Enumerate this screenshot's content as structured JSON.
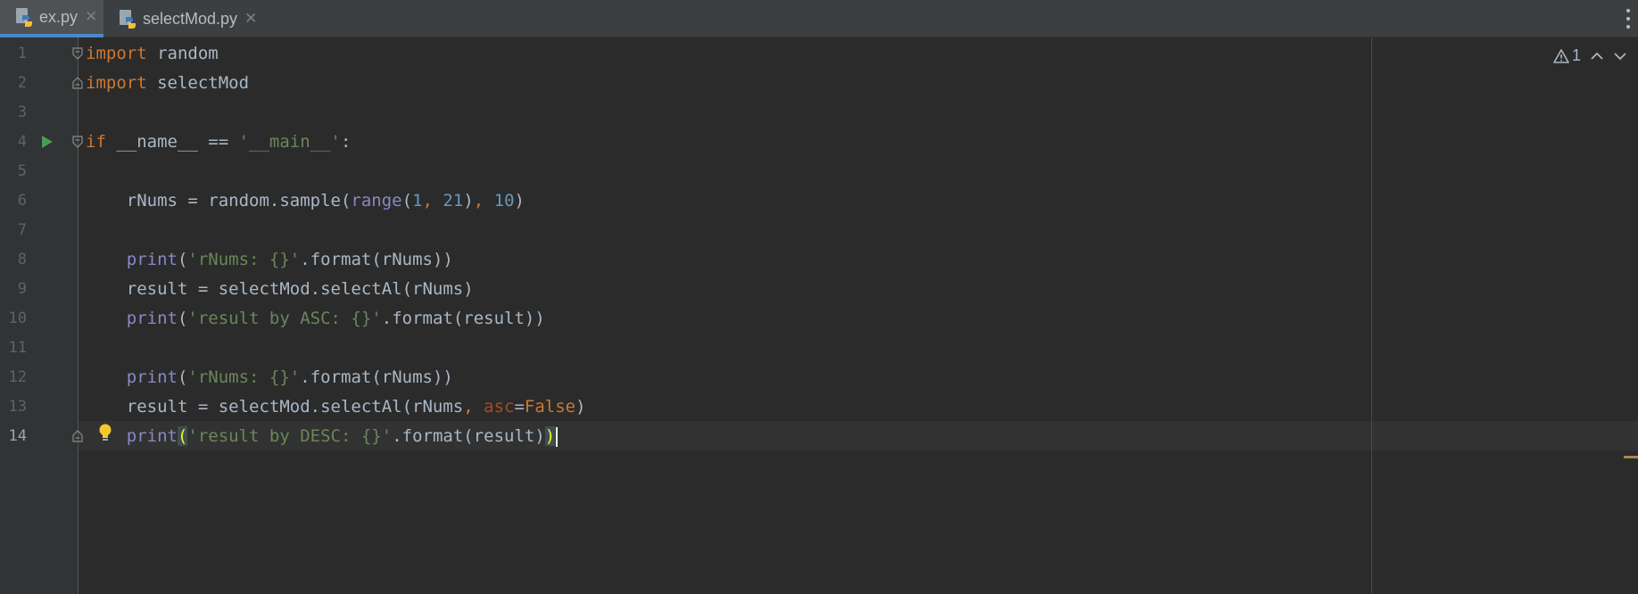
{
  "tabs": [
    {
      "name": "ex.py",
      "active": true
    },
    {
      "name": "selectMod.py",
      "active": false
    }
  ],
  "tab_close_glyph": "✕",
  "inspection": {
    "warning_count": "1",
    "warning_icon": "warning-triangle-icon",
    "prev_icon": "chevron-up-icon",
    "next_icon": "chevron-down-icon"
  },
  "editor": {
    "current_line": 14,
    "line_numbers": [
      "1",
      "2",
      "3",
      "4",
      "5",
      "6",
      "7",
      "8",
      "9",
      "10",
      "11",
      "12",
      "13",
      "14"
    ],
    "lines": {
      "l1": {
        "kw": "import",
        "rest": " random"
      },
      "l2": {
        "kw": "import",
        "rest": " selectMod"
      },
      "l4": {
        "kw": "if",
        "a": " __name__ == ",
        "str": "'__main__'",
        "b": ":"
      },
      "l6": {
        "a": "    rNums = random.sample(",
        "builtin": "range",
        "b": "(",
        "n1": "1",
        "c1": ", ",
        "n2": "21",
        "c2": ")",
        "c3": ", ",
        "n3": "10",
        "d": ")"
      },
      "l8": {
        "builtin": "    print",
        "a": "(",
        "str": "'rNums: {}'",
        "b": ".format(rNums))"
      },
      "l9": {
        "a": "    result = selectMod.selectAl(rNums)"
      },
      "l10": {
        "builtin": "    print",
        "a": "(",
        "str": "'result by ASC: {}'",
        "b": ".format(result))"
      },
      "l12": {
        "builtin": "    print",
        "a": "(",
        "str": "'rNums: {}'",
        "b": ".format(rNums))"
      },
      "l13": {
        "a": "    result = selectMod.selectAl(rNums",
        "comma": ", ",
        "param": "asc",
        "eq": "=",
        "kw": "False",
        "b": ")"
      },
      "l14": {
        "builtin": "    print",
        "open": "(",
        "str": "'result by DESC: {}'",
        "b": ".format(result)",
        "close": ")"
      }
    }
  },
  "colors": {
    "background": "#2b2b2b",
    "keyword": "#cc7832",
    "string": "#6a8759",
    "number": "#6897bb",
    "builtin": "#8888c6",
    "parameter": "#aa4926",
    "text": "#a9b7c6",
    "tab_accent": "#4a88c7"
  }
}
